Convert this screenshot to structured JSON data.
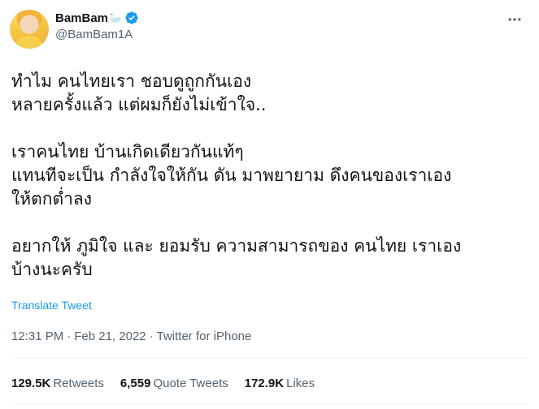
{
  "user": {
    "display_name": "BamBam",
    "name_emoji": "🦢",
    "handle": "@BamBam1A",
    "verified": true,
    "avatar_icon": "user-avatar-photo",
    "verified_icon": "verified-badge-icon"
  },
  "more_icon": "more-options-icon",
  "tweet": {
    "paragraphs": [
      [
        "ทำไม คนไทยเรา ชอบดูถูกกันเอง",
        "หลายครั้งแล้ว แต่ผมก็ยังไม่เข้าใจ.."
      ],
      [
        "เราคนไทย บ้านเกิดเดียวกันแท้ๆ",
        "แทนทีจะเป็น กำลังใจให้กัน ดัน มาพยายาม ดึงคนของเราเอง",
        "ให้ตกต่ำลง"
      ],
      [
        "อยากให้ ภูมิใจ และ ยอมรับ ความสามารถของ คนไทย เราเอง",
        "บ้างนะครับ"
      ]
    ],
    "translate_label": "Translate Tweet",
    "time": "12:31 PM",
    "date": "Feb 21, 2022",
    "separator": "·",
    "source": "Twitter for iPhone"
  },
  "stats": {
    "retweets": {
      "num": "129.5K",
      "label": "Retweets"
    },
    "quotes": {
      "num": "6,559",
      "label": "Quote Tweets"
    },
    "likes": {
      "num": "172.9K",
      "label": "Likes"
    }
  },
  "colors": {
    "link": "#1d9bf0",
    "secondary": "#536471",
    "primary": "#0f1419",
    "divider": "#eff3f4"
  }
}
